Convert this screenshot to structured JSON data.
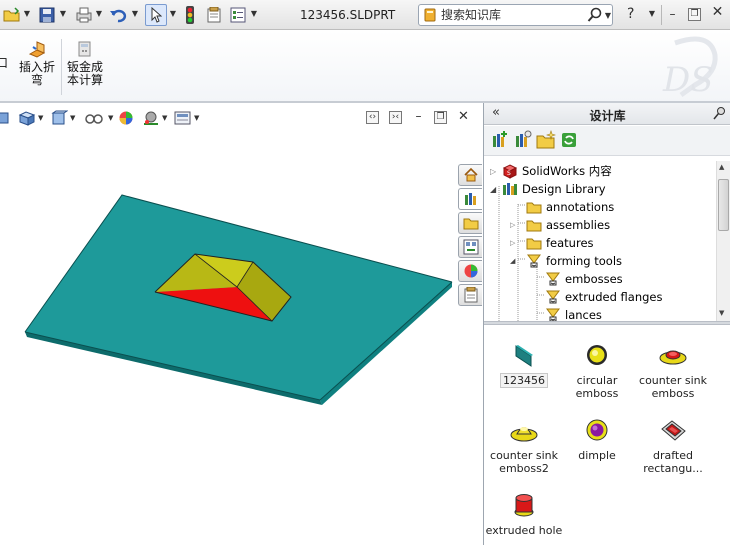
{
  "window": {
    "document_title": "123456.SLDPRT",
    "search_placeholder": "搜索知识库",
    "help_label": "?"
  },
  "ribbon": {
    "partial_label": "口",
    "insert_bend_label": "插入折弯",
    "sheet_cost_label": "钣金成本计算"
  },
  "design_library": {
    "title": "设计库",
    "collapse_label": "«",
    "tree": [
      {
        "label": "SolidWorks 内容",
        "icon": "solidworks-content-icon"
      },
      {
        "label": "Design Library",
        "icon": "design-library-icon"
      },
      {
        "label": "annotations",
        "icon": "folder-icon"
      },
      {
        "label": "assemblies",
        "icon": "folder-icon"
      },
      {
        "label": "features",
        "icon": "folder-icon"
      },
      {
        "label": "forming tools",
        "icon": "forming-tool-folder-icon"
      },
      {
        "label": "embosses",
        "icon": "forming-tool-folder-icon"
      },
      {
        "label": "extruded flanges",
        "icon": "forming-tool-folder-icon"
      },
      {
        "label": "lances",
        "icon": "forming-tool-folder-icon"
      }
    ],
    "items": [
      {
        "label": "123456",
        "icon": "part-icon"
      },
      {
        "label": "circular emboss",
        "icon": "circular-emboss-icon"
      },
      {
        "label": "counter sink emboss",
        "icon": "counter-sink-emboss-icon"
      },
      {
        "label": "counter sink emboss2",
        "icon": "counter-sink-emboss2-icon"
      },
      {
        "label": "dimple",
        "icon": "dimple-icon"
      },
      {
        "label": "drafted rectangu...",
        "icon": "drafted-rectangular-icon"
      },
      {
        "label": "extruded hole",
        "icon": "extruded-hole-icon"
      }
    ]
  },
  "colors": {
    "plate_top": "#1e9a9a",
    "boss_yellow": "#b8b815",
    "boss_red": "#ee1010",
    "accent": "#2a5cad"
  }
}
